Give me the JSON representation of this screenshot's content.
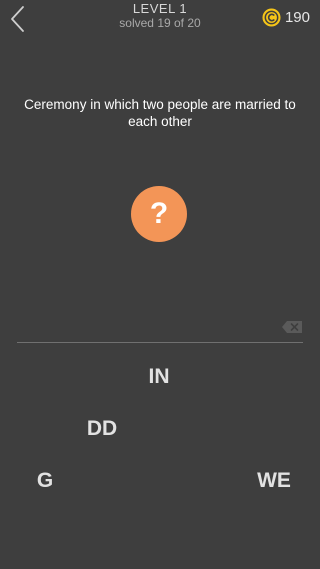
{
  "header": {
    "level_title": "LEVEL 1",
    "level_progress": "solved 19 of 20",
    "coins": "190",
    "back_icon": "chevron-left-icon",
    "coin_icon": "coin-icon"
  },
  "clue": {
    "text": "Ceremony in which two people are married to each other"
  },
  "hint": {
    "symbol": "?",
    "color": "#f39557"
  },
  "answer": {
    "delete_icon": "backspace-icon"
  },
  "tiles": [
    "IN",
    "DD",
    "G",
    "WE"
  ],
  "colors": {
    "background": "#3e3e3e",
    "coin": "#f5c518",
    "tile_text": "#e2e2e2"
  }
}
